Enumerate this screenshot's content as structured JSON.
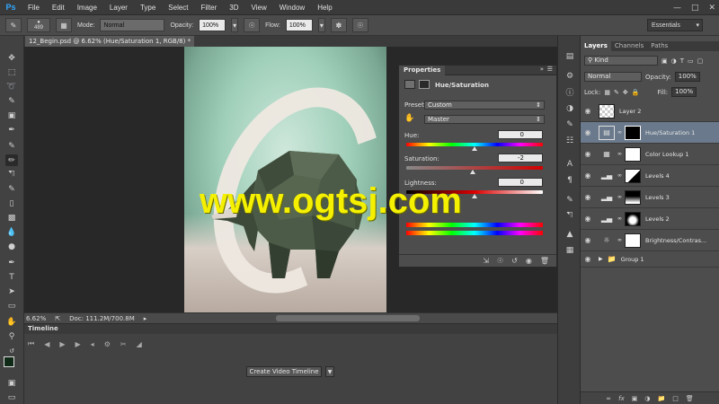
{
  "app": {
    "logo": "Ps",
    "menu": [
      "File",
      "Edit",
      "Image",
      "Layer",
      "Type",
      "Select",
      "Filter",
      "3D",
      "View",
      "Window",
      "Help"
    ]
  },
  "options_bar": {
    "brush_size": "489",
    "mode_label": "Mode:",
    "mode_value": "Normal",
    "opacity_label": "Opacity:",
    "opacity_value": "100%",
    "flow_label": "Flow:",
    "flow_value": "100%",
    "workspace": "Essentials"
  },
  "document": {
    "tab_title": "12_Begin.psd @ 6.62% (Hue/Saturation 1, RGB/8) *",
    "zoom": "6.62%",
    "doc_size": "Doc: 111.2M/700.8M"
  },
  "timeline": {
    "title": "Timeline",
    "create_button": "Create Video Timeline"
  },
  "properties": {
    "tab": "Properties",
    "adjustment_title": "Hue/Saturation",
    "preset_label": "Preset:",
    "preset_value": "Custom",
    "channel_value": "Master",
    "hue_label": "Hue:",
    "hue_value": "0",
    "hue_fraction": 0.5,
    "saturation_label": "Saturation:",
    "saturation_value": "-2",
    "saturation_fraction": 0.49,
    "lightness_label": "Lightness:",
    "lightness_value": "0",
    "lightness_fraction": 0.5
  },
  "layers_panel": {
    "tabs": [
      "Layers",
      "Channels",
      "Paths"
    ],
    "filter_kind": "Kind",
    "blend_mode": "Normal",
    "opacity_label": "Opacity:",
    "opacity_value": "100%",
    "lock_label": "Lock:",
    "fill_label": "Fill:",
    "fill_value": "100%",
    "layers": [
      {
        "name": "Layer 2",
        "type": "pixel"
      },
      {
        "name": "Hue/Saturation 1",
        "type": "adjustment",
        "selected": true
      },
      {
        "name": "Color Lookup 1",
        "type": "adjustment"
      },
      {
        "name": "Levels 4",
        "type": "adjustment"
      },
      {
        "name": "Levels 3",
        "type": "adjustment"
      },
      {
        "name": "Levels 2",
        "type": "adjustment"
      },
      {
        "name": "Brightness/Contras...",
        "type": "adjustment"
      },
      {
        "name": "Group 1",
        "type": "group"
      }
    ]
  },
  "watermark": "www.ogtsj.com",
  "colors": {
    "accent": "#31a8ff",
    "selected_layer": "#6a7a8c",
    "watermark": "#f4f000"
  }
}
